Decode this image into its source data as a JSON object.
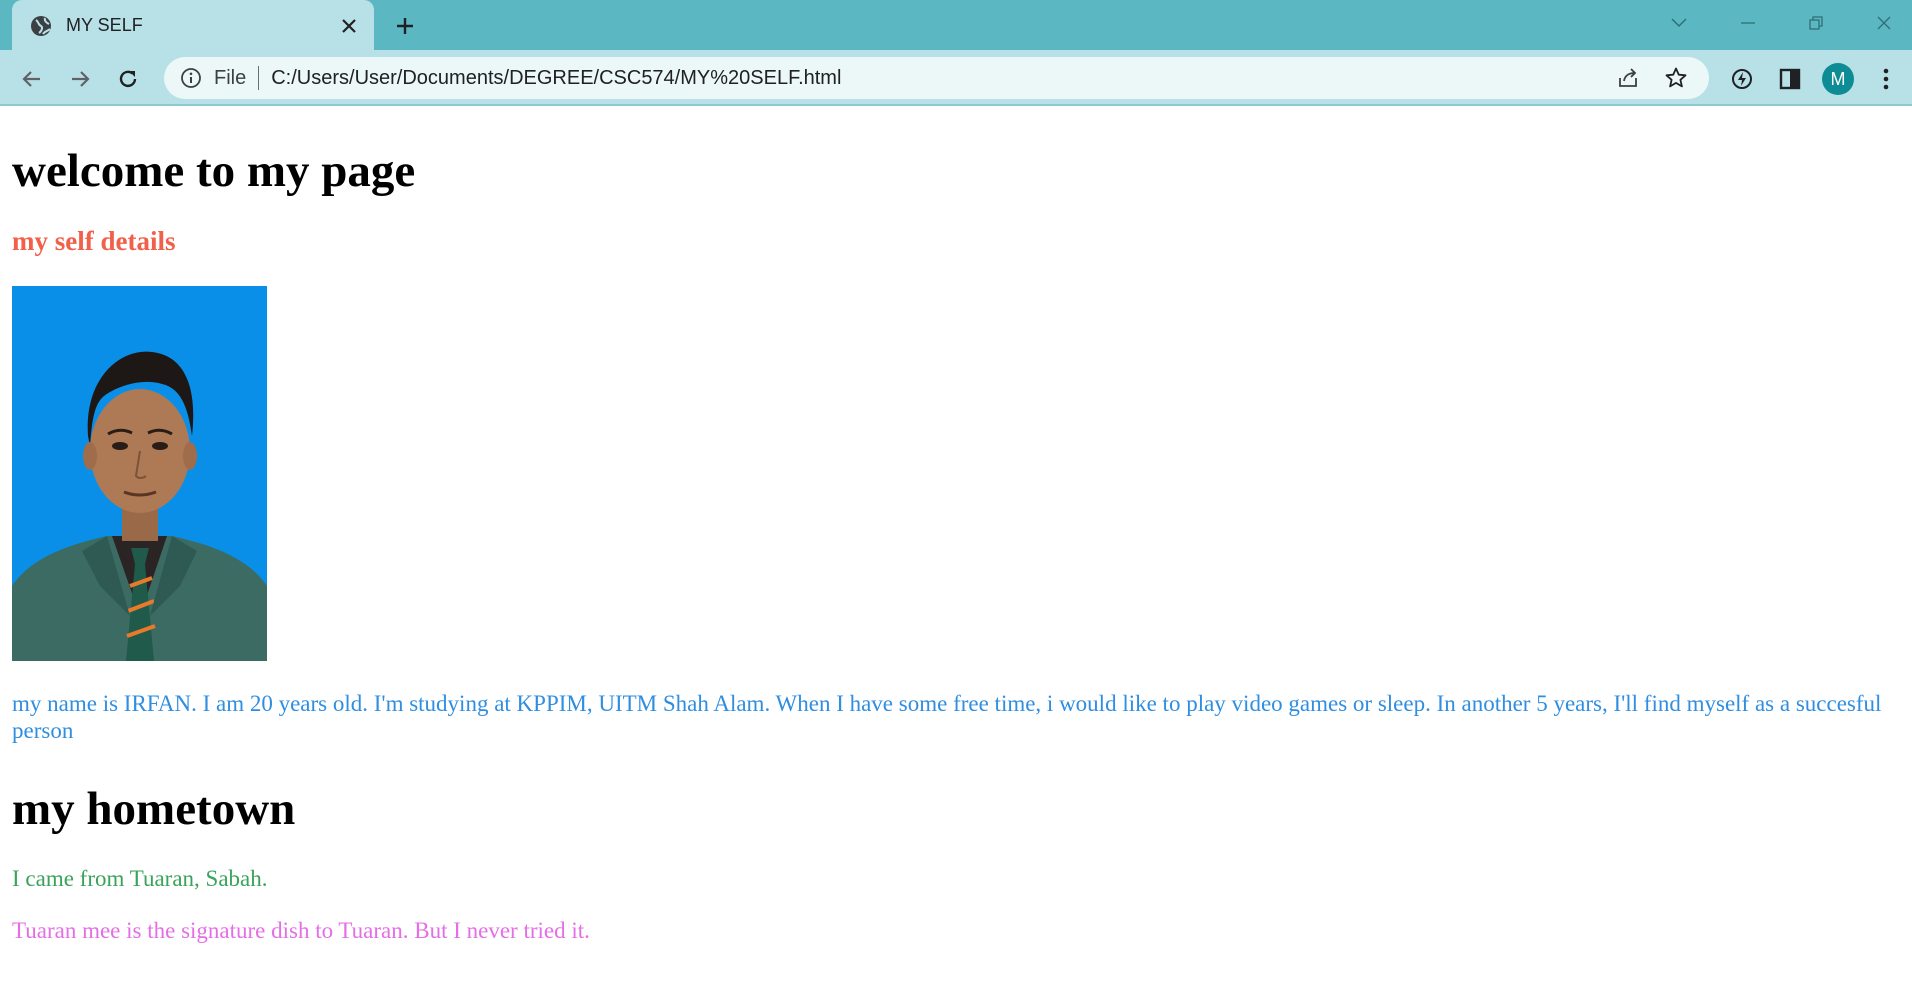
{
  "browser": {
    "tab_title": "MY SELF",
    "address_scheme": "File",
    "address_url": "C:/Users/User/Documents/DEGREE/CSC574/MY%20SELF.html",
    "profile_initial": "M"
  },
  "page": {
    "heading": "welcome to my page",
    "subheading": "my self details",
    "bio": "my name is IRFAN. I am 20 years old. I'm studying at KPPIM, UITM Shah Alam. When I have some free time, i would like to play video games or sleep. In another 5 years, I'll find myself as a succesful person",
    "hometown_heading": "my hometown",
    "hometown_line1": "I came from Tuaran, Sabah.",
    "hometown_line2": "Tuaran mee is the signature dish to Tuaran. But I never tried it."
  },
  "colors": {
    "chrome": "#5bb8c2",
    "toolbar": "#b7e1e6",
    "subheading": "#f2604a",
    "bio": "#2f8ee0",
    "hometown_line1": "#3aa35a",
    "hometown_line2": "#e56ee6",
    "photo_background": "#0a8fe8"
  },
  "icons": {
    "tab_favicon": "globe-icon",
    "tab_close": "close-icon",
    "new_tab": "plus-icon",
    "back": "arrow-left-icon",
    "forward": "arrow-right-icon",
    "reload": "reload-icon",
    "site_info": "info-icon",
    "share": "share-icon",
    "bookmark": "star-icon",
    "extension": "extension-icon",
    "side_panel": "side-panel-icon",
    "menu": "kebab-menu-icon"
  }
}
